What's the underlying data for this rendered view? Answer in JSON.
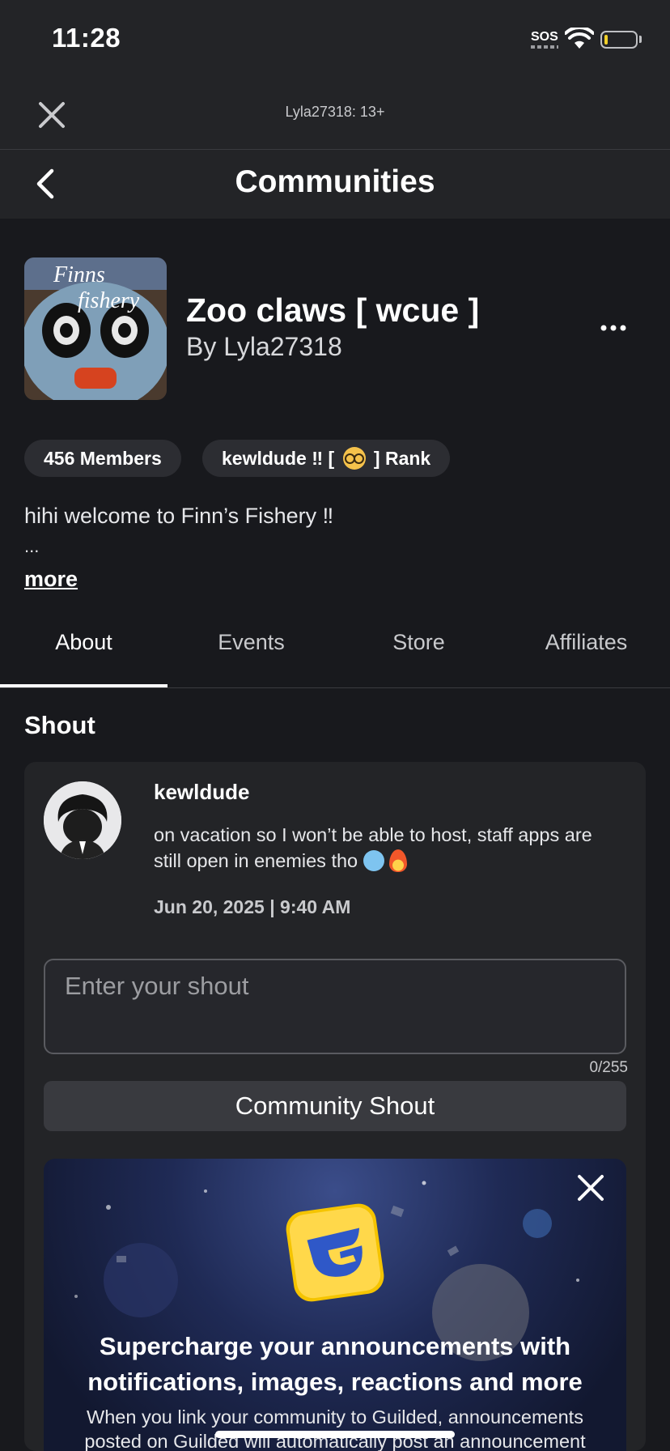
{
  "status_bar": {
    "time": "11:28",
    "sos": "SOS"
  },
  "top_bar": {
    "account_label": "Lyla27318: 13+"
  },
  "nav": {
    "title": "Communities"
  },
  "group": {
    "name": "Zoo claws [ wcue ]",
    "owner": "By Lyla27318",
    "icon_text_1": "Finns",
    "icon_text_2": "fishery",
    "members": "456 Members",
    "rank_prefix": "kewldude ‼ [",
    "rank_suffix": "] Rank",
    "description": "hihi welcome to Finn’s Fishery ‼",
    "ellipsis": "...",
    "more_label": "more"
  },
  "tabs": [
    {
      "label": "About",
      "active": true
    },
    {
      "label": "Events",
      "active": false
    },
    {
      "label": "Store",
      "active": false
    },
    {
      "label": "Affiliates",
      "active": false
    }
  ],
  "shout": {
    "section_title": "Shout",
    "poster": "kewldude",
    "body_line1": "on vacation so I won’t be able to host, staff apps are",
    "body_line2": "still open in enemies tho",
    "timestamp": "Jun 20, 2025 | 9:40 AM",
    "input_placeholder": "Enter your shout",
    "char_count": "0/255",
    "button_label": "Community Shout"
  },
  "promo": {
    "title_line1": "Supercharge your announcements with",
    "title_line2": "notifications, images, reactions and more",
    "text_line1": "When you link your community to Guilded, announcements",
    "text_line2": "posted on Guilded will automatically post an announcement"
  },
  "colors": {
    "background": "#18191d",
    "bar": "#232427",
    "card": "#232427",
    "pill": "#2c2d32",
    "button": "#393a3f",
    "guilded_yellow": "#f5c400"
  }
}
